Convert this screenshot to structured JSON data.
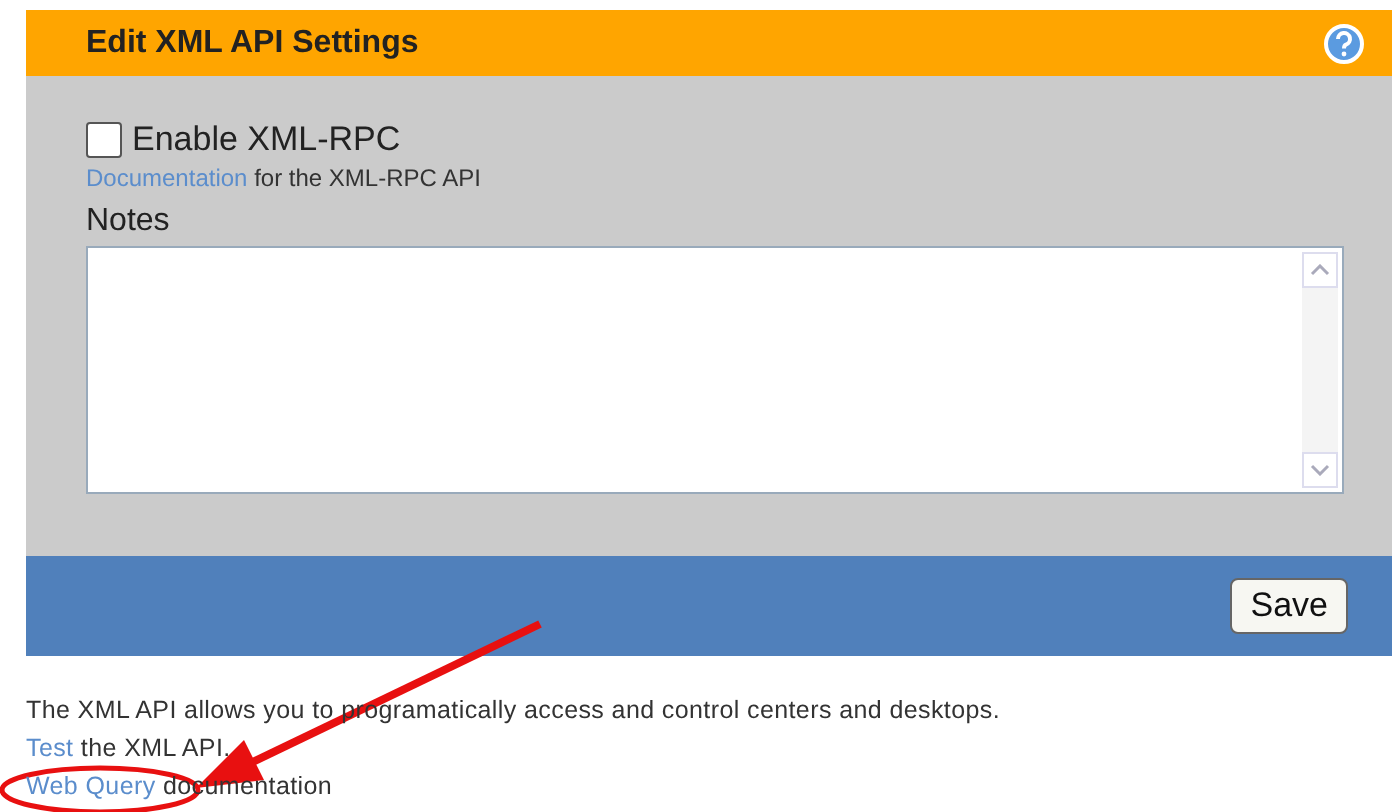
{
  "panel": {
    "title": "Edit XML API Settings",
    "enable_xmlrpc": {
      "label": "Enable XML-RPC",
      "checked": false
    },
    "doc_line": {
      "link": "Documentation",
      "text": "for the XML-RPC API"
    },
    "notes": {
      "label": "Notes"
    },
    "save_button": "Save"
  },
  "footer": {
    "description": "The XML API allows you to programatically access and control centers and desktops.",
    "test_line": {
      "link": "Test",
      "text": "the XML API."
    },
    "query_line": {
      "link": "Web Query",
      "text": "documentation"
    }
  }
}
